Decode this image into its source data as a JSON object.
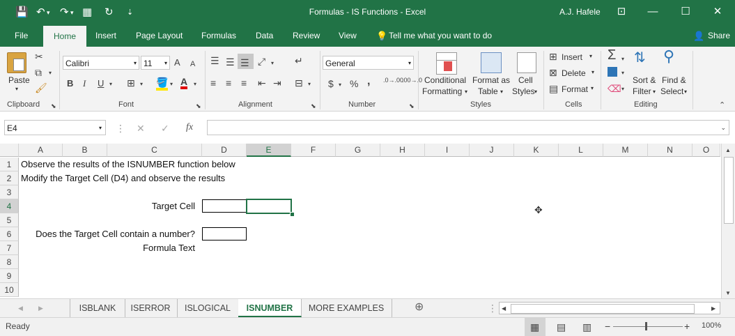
{
  "window": {
    "title": "Formulas - IS Functions  -  Excel",
    "user": "A.J. Hafele",
    "minimize": "—",
    "restore": "☐",
    "close": "✕",
    "ribbon_display": "⊡"
  },
  "qat": {
    "save": "💾",
    "undo": "↶",
    "redo": "↷",
    "sort": "▦",
    "repeat": "↻",
    "customize": "⇣"
  },
  "tabs": [
    "File",
    "Home",
    "Insert",
    "Page Layout",
    "Formulas",
    "Data",
    "Review",
    "View"
  ],
  "tell_me": "Tell me what you want to do",
  "share": "Share",
  "ribbon": {
    "clipboard": {
      "label": "Clipboard",
      "paste": "Paste"
    },
    "font": {
      "label": "Font",
      "name": "Calibri",
      "size": "11",
      "bold": "B",
      "italic": "I",
      "underline": "U",
      "grow": "A",
      "shrink": "A"
    },
    "alignment": {
      "label": "Alignment"
    },
    "number": {
      "label": "Number",
      "format": "General",
      "currency": "$",
      "percent": "%",
      "comma": ",",
      "inc_decimal": ".0→.00",
      "dec_decimal": ".00→.0"
    },
    "styles": {
      "label": "Styles",
      "conditional_1": "Conditional",
      "conditional_2": "Formatting",
      "format_as_1": "Format as",
      "format_as_2": "Table",
      "cell_1": "Cell",
      "cell_2": "Styles"
    },
    "cells": {
      "label": "Cells",
      "insert": "Insert",
      "delete": "Delete",
      "format": "Format"
    },
    "editing": {
      "label": "Editing",
      "sort_1": "Sort &",
      "sort_2": "Filter",
      "find_1": "Find &",
      "find_2": "Select"
    }
  },
  "formula_bar": {
    "name_box": "E4",
    "cancel": "✕",
    "enter": "✓",
    "fx": "fx",
    "value": ""
  },
  "columns": [
    "A",
    "B",
    "C",
    "D",
    "E",
    "F",
    "G",
    "H",
    "I",
    "J",
    "K",
    "L",
    "M",
    "N",
    "O"
  ],
  "selected_column": "E",
  "rows": [
    "1",
    "2",
    "3",
    "4",
    "5",
    "6",
    "7",
    "8",
    "9",
    "10"
  ],
  "selected_row": "4",
  "cells": {
    "a1": "Observe the results of the ISNUMBER function below",
    "a2": "Modify the Target Cell (D4) and observe the results",
    "c4": "Target Cell",
    "c6": "Does the Target Cell contain a number?",
    "c7": "Formula Text"
  },
  "sheet_tabs": [
    "ISBLANK",
    "ISERROR",
    "ISLOGICAL",
    "ISNUMBER",
    "MORE EXAMPLES"
  ],
  "active_sheet": "ISNUMBER",
  "status": {
    "ready": "Ready",
    "zoom": "100%"
  },
  "colors": {
    "accent": "#217346"
  }
}
